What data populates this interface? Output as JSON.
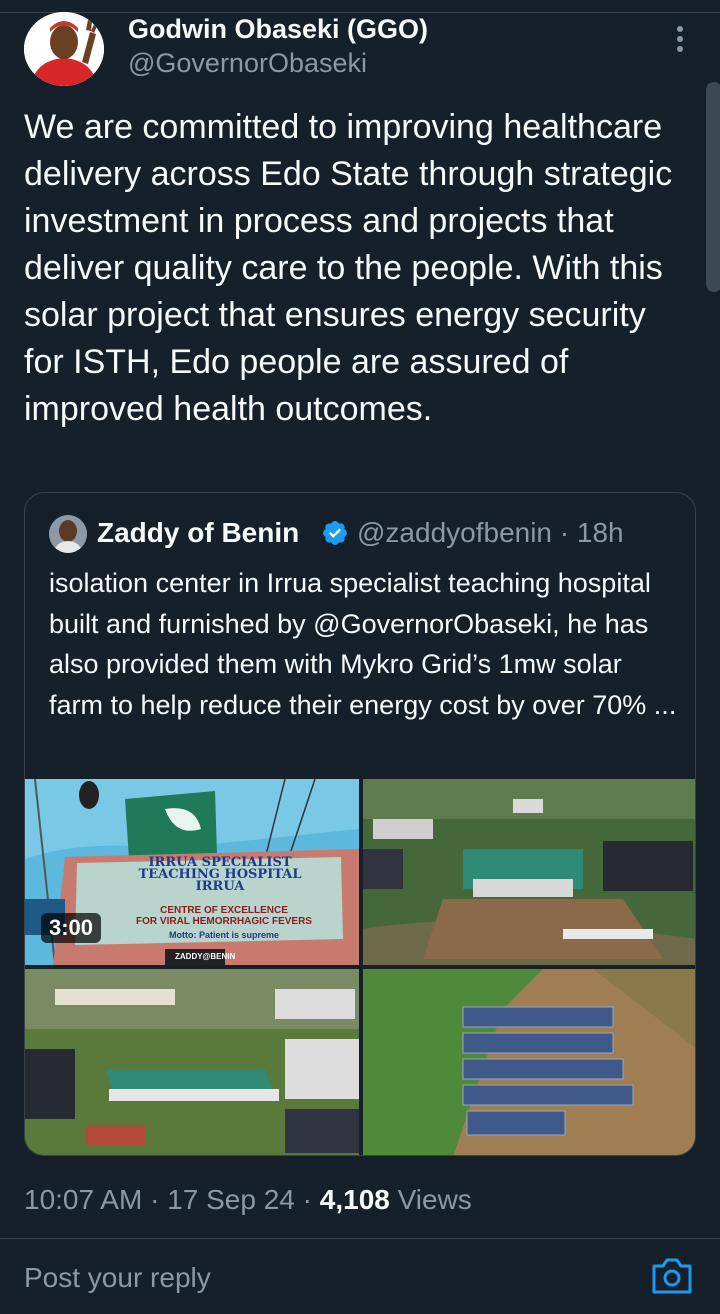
{
  "tweet": {
    "author_name": "Godwin Obaseki (GGO)",
    "author_handle": "@GovernorObaseki",
    "text": "We are committed to improving healthcare delivery across Edo State through strategic investment in process and projects that deliver quality care to the people. With this solar project that ensures energy security for ISTH, Edo people are assured of improved health outcomes.",
    "time": "10:07 AM",
    "date": "17 Sep 24",
    "separator": " · ",
    "views_count": "4,108",
    "views_label": "Views"
  },
  "quote": {
    "author_name": "Zaddy of Benin",
    "author_handle": "@zaddyofbenin",
    "age": "18h",
    "text": "isolation center in Irrua specialist teaching hospital built and furnished by @GovernorObaseki, he has also provided them with Mykro Grid’s 1mw solar farm to help reduce their energy cost by over 70% ...",
    "video_duration": "3:00",
    "sign": {
      "line1": "IRRUA SPECIALIST",
      "line2": "TEACHING HOSPITAL",
      "line3": "IRRUA",
      "line4": "CENTRE OF EXCELLENCE",
      "line5": "FOR VIRAL HEMORRHAGIC FEVERS",
      "line6": "Motto: Patient is supreme",
      "watermark": "ZADDY@BENIN"
    }
  },
  "reply": {
    "placeholder": "Post your reply"
  },
  "icons": {
    "more": "more-vertical-icon",
    "verified": "verified-badge-icon",
    "camera": "camera-icon"
  },
  "colors": {
    "background": "#15202b",
    "text": "#f7f9f9",
    "secondary": "#8b98a5",
    "accent": "#1d9bf0",
    "border": "#38444d"
  }
}
